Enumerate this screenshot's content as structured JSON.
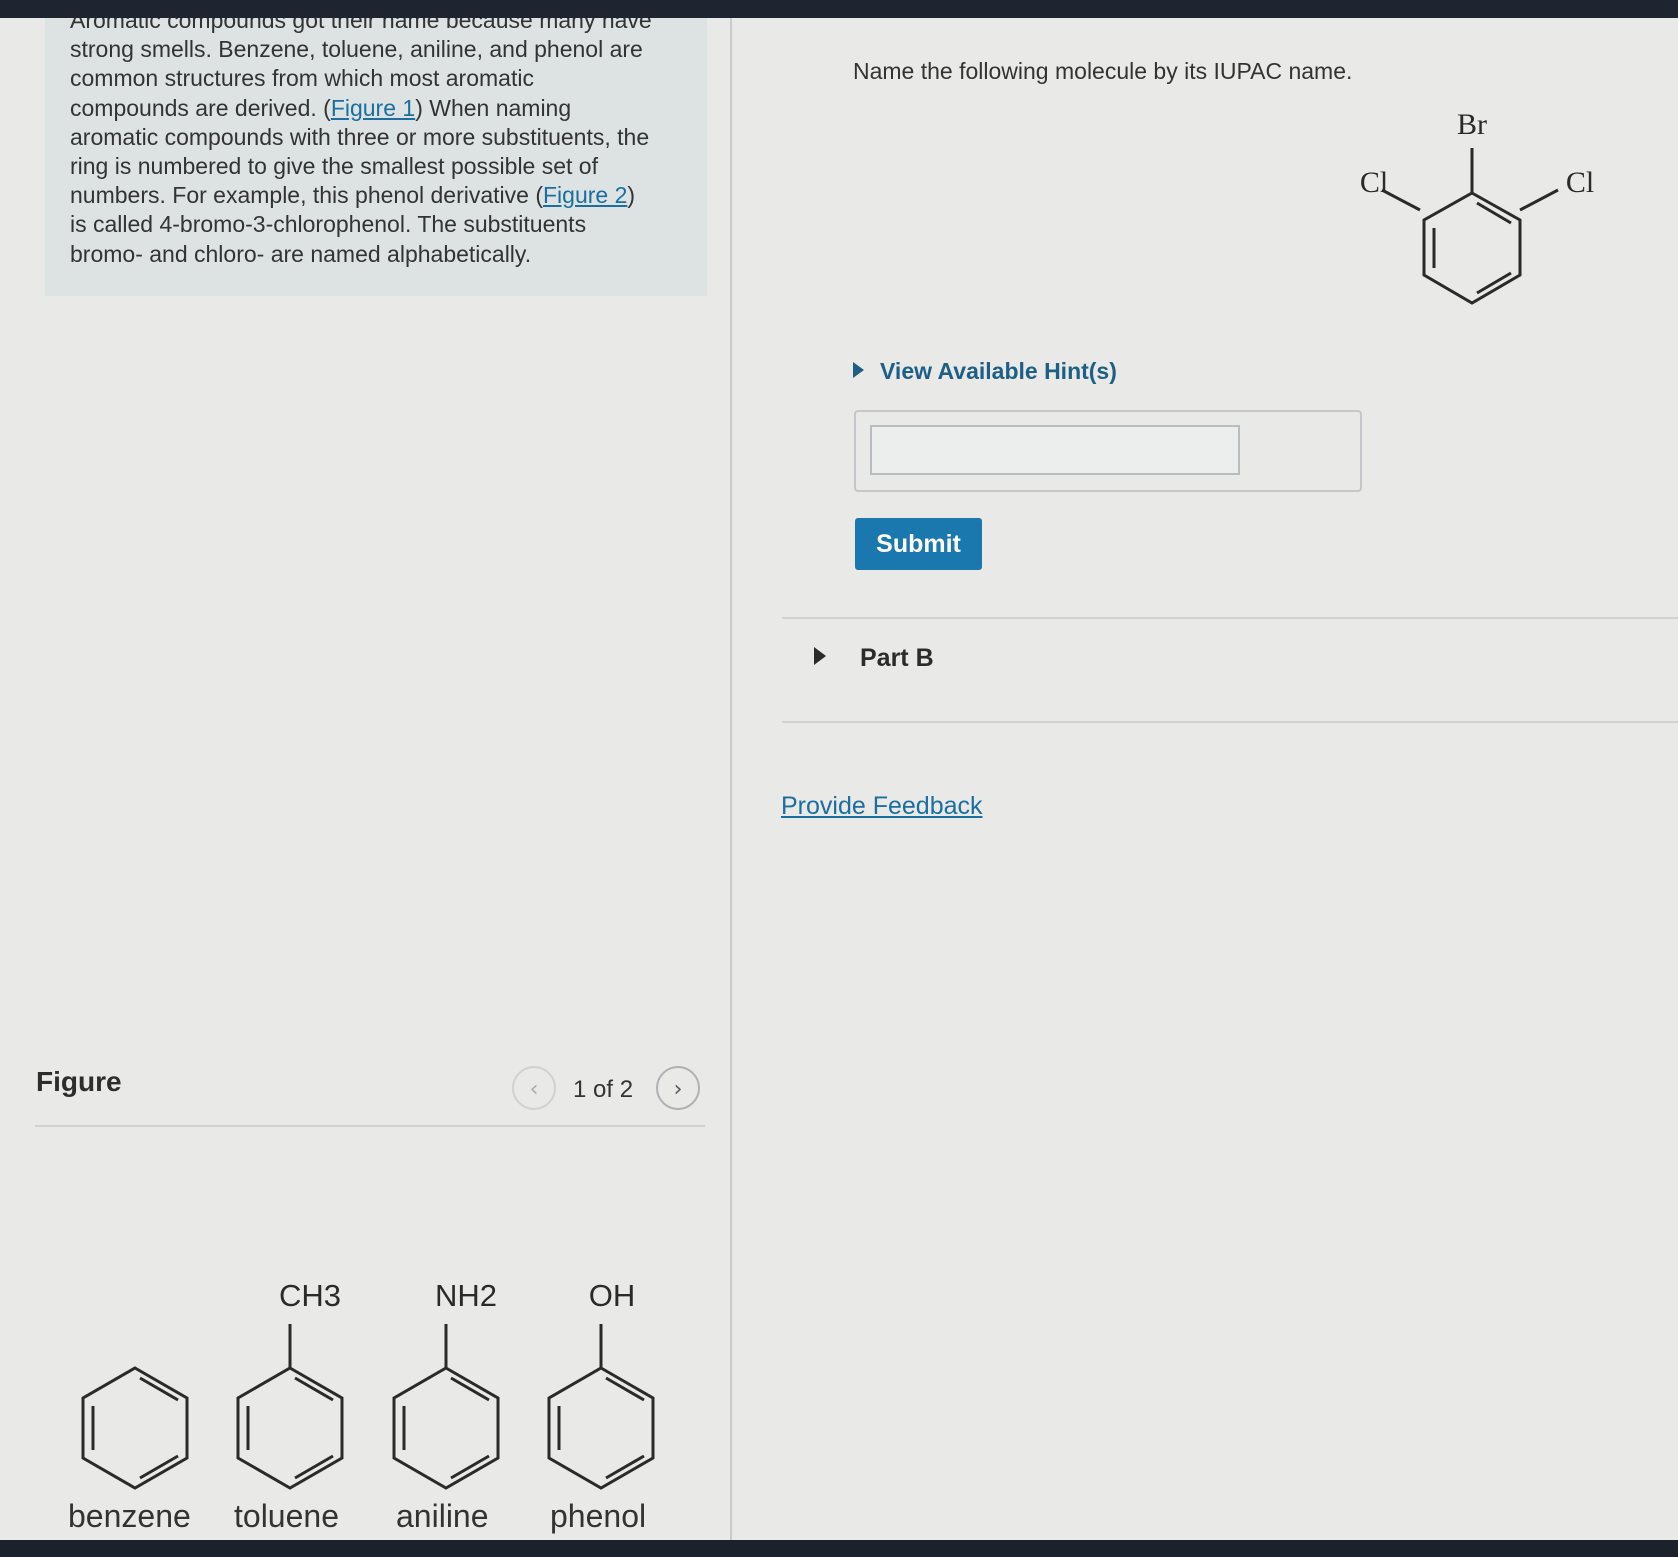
{
  "intro": {
    "cut_line": "Aromatic compounds got their name because many have",
    "lines": [
      "strong smells. Benzene, toluene, aniline, and phenol are",
      "common structures from which most aromatic",
      "aromatic compounds with three or more substituents, the",
      "ring is numbered to give the smallest possible set of",
      "is called 4-bromo-3-chlorophenol. The substituents",
      "bromo- and chloro- are named alphabetically."
    ],
    "line4_pre": "compounds are derived. (",
    "figure1_link": "Figure 1",
    "line4_post": ") When naming",
    "line7_pre": "numbers. For example, this phenol derivative (",
    "figure2_link": "Figure 2",
    "line7_post": ")"
  },
  "figure": {
    "label": "Figure",
    "pager": "1 of 2",
    "prev_icon": "chevron-left-icon",
    "next_icon": "chevron-right-icon",
    "prev_glyph": "‹",
    "next_glyph": "›",
    "substituents": [
      "CH3",
      "NH2",
      "OH"
    ],
    "names": [
      "benzene",
      "toluene",
      "aniline",
      "phenol"
    ]
  },
  "question": {
    "prompt": "Name the following molecule by its IUPAC name.",
    "molecule_labels": {
      "top": "Br",
      "left": "Cl",
      "right": "Cl"
    },
    "hints_label": "View Available Hint(s)",
    "answer_value": "",
    "submit_label": "Submit",
    "part_b_label": "Part B",
    "feedback_label": "Provide Feedback"
  },
  "colors": {
    "link": "#1a6fa0",
    "submit_bg": "#1a78ae",
    "hint_text": "#1d5f86",
    "intro_bg": "#dde3e2",
    "page_bg": "#e9e9e7"
  }
}
